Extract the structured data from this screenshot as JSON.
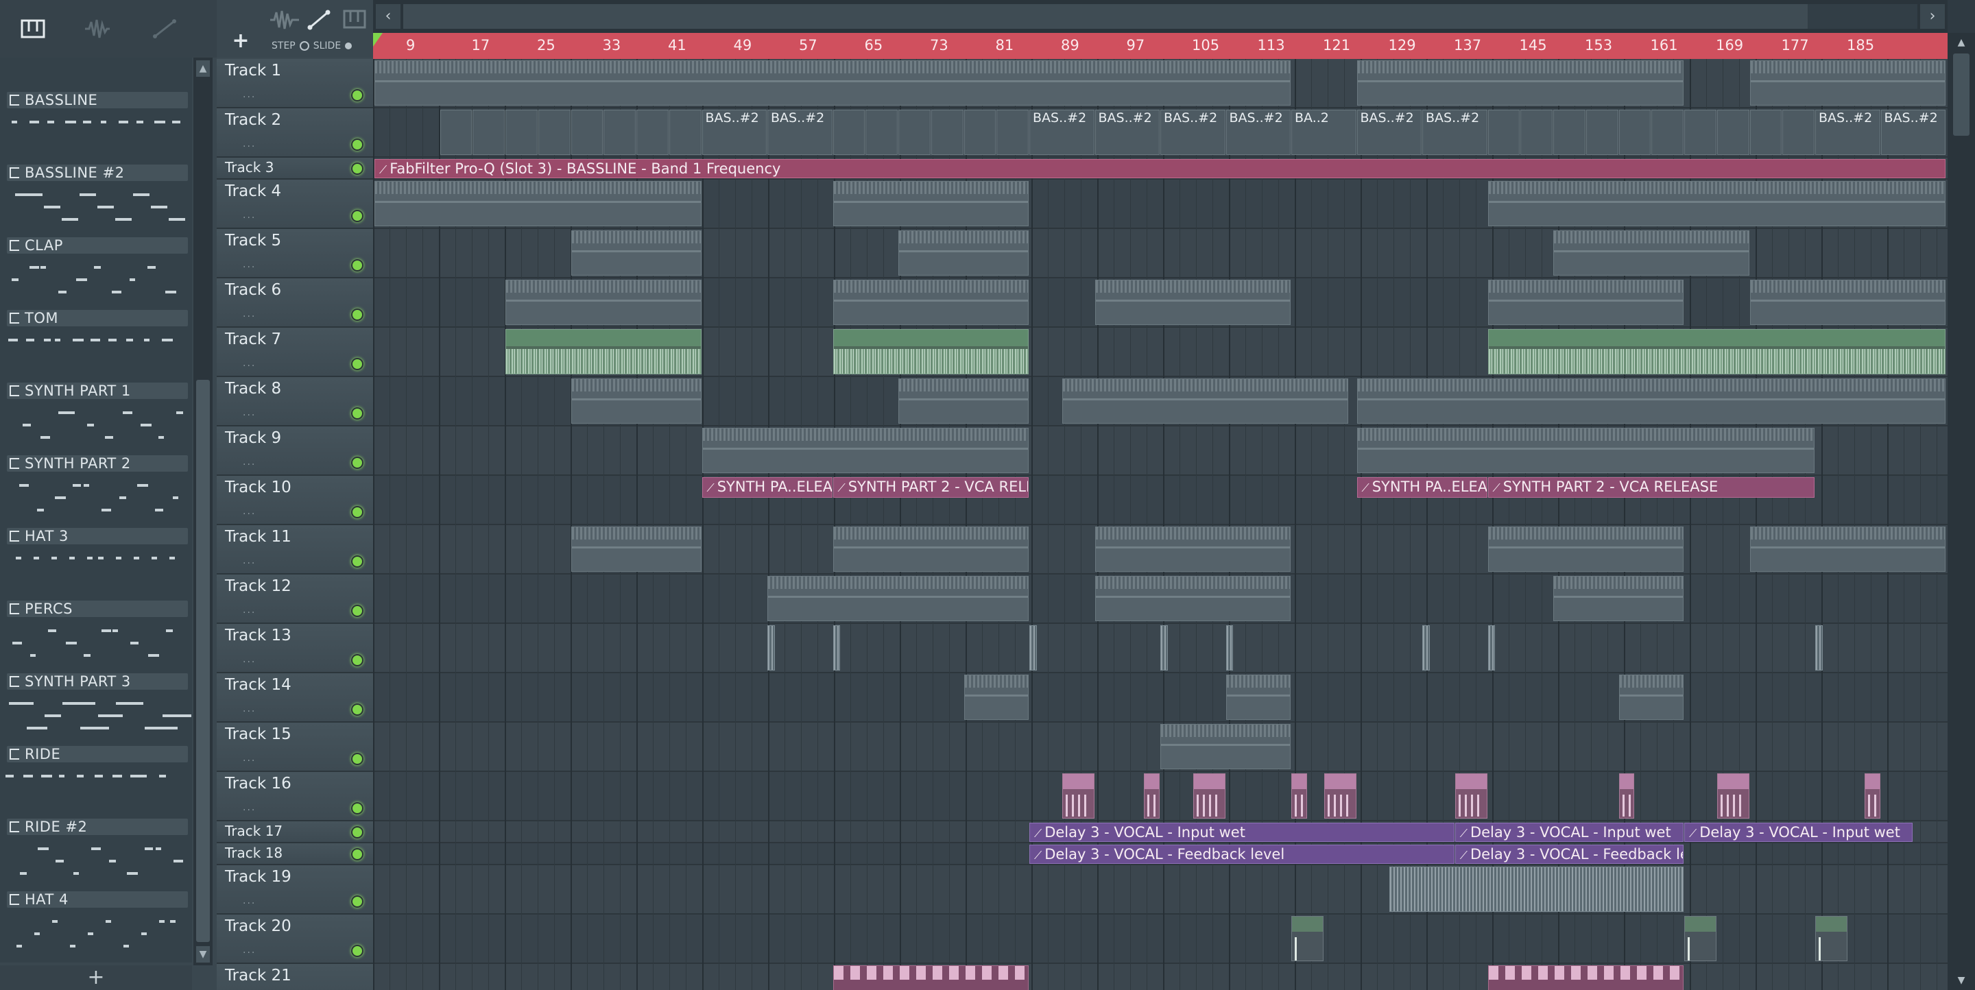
{
  "picker": {
    "patterns": [
      {
        "label": "BASSLINE"
      },
      {
        "label": "BASSLINE #2"
      },
      {
        "label": "CLAP"
      },
      {
        "label": "TOM"
      },
      {
        "label": "SYNTH PART 1"
      },
      {
        "label": "SYNTH PART 2"
      },
      {
        "label": "HAT 3"
      },
      {
        "label": "PERCS"
      },
      {
        "label": "SYNTH PART 3"
      },
      {
        "label": "RIDE"
      },
      {
        "label": "RIDE #2"
      },
      {
        "label": "HAT 4"
      }
    ],
    "add_label": "+"
  },
  "toolbar": {
    "add_track_label": "+",
    "step_label": "STEP",
    "slide_label": "SLIDE"
  },
  "tracks": [
    {
      "name": "Track 1"
    },
    {
      "name": "Track 2"
    },
    {
      "name": "Track 3"
    },
    {
      "name": "Track 4"
    },
    {
      "name": "Track 5"
    },
    {
      "name": "Track 6"
    },
    {
      "name": "Track 7"
    },
    {
      "name": "Track 8"
    },
    {
      "name": "Track 9"
    },
    {
      "name": "Track 10"
    },
    {
      "name": "Track 11"
    },
    {
      "name": "Track 12"
    },
    {
      "name": "Track 13"
    },
    {
      "name": "Track 14"
    },
    {
      "name": "Track 15"
    },
    {
      "name": "Track 16"
    },
    {
      "name": "Track 17"
    },
    {
      "name": "Track 18"
    },
    {
      "name": "Track 19"
    },
    {
      "name": "Track 20"
    },
    {
      "name": "Track 21"
    }
  ],
  "ruler": {
    "ticks": [
      "9",
      "17",
      "25",
      "33",
      "41",
      "49",
      "57",
      "65",
      "73",
      "81",
      "89",
      "97",
      "105",
      "113",
      "121",
      "129",
      "137",
      "145",
      "153",
      "161",
      "169",
      "177",
      "185"
    ]
  },
  "clips": {
    "bass_label": "BAS..#2",
    "bass_short": "BA..2",
    "t3_auto": "FabFilter Pro-Q (Slot 3) - BASSLINE - Band 1 Frequency",
    "t10_a": "SYNTH PA..ELEASE",
    "t10_b": "SYNTH PART 2 - VCA RELEASE",
    "t17": "Delay 3 - VOCAL - Input wet",
    "t18": "Delay 3 - VOCAL - Feedback level"
  },
  "colors": {
    "ruler": "#d0505e",
    "led": "#7fd64c",
    "audio": "#5f8a6c",
    "automation": "#8e4d72"
  }
}
